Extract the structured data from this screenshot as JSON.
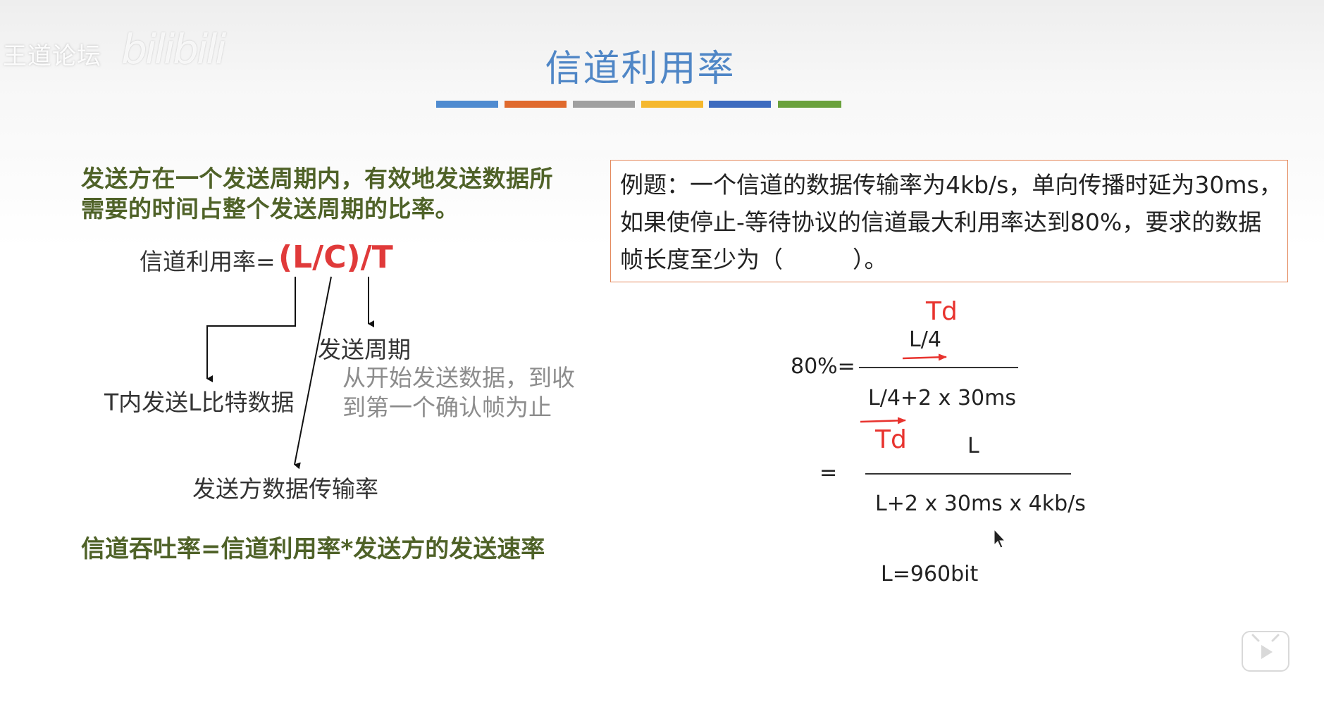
{
  "watermark": {
    "forum_text": "王道论坛",
    "bili_text": "bilibili"
  },
  "slide": {
    "title": "信道利用率",
    "color_bars": [
      "#4f8bd0",
      "#e06a2d",
      "#a0a0a0",
      "#f5b82e",
      "#3d6bbf",
      "#6aa13c"
    ],
    "definition": "发送方在一个发送周期内，有效地发送数据所需要的时间占整个发送周期的比率。",
    "formula_label": "信道利用率=",
    "formula": "(L/C)/T",
    "label_send_period": "发送周期",
    "label_T_data": "T内发送L比特数据",
    "note_line1": "从开始发送数据，到收",
    "note_line2": "到第一个确认帧为止",
    "label_rate": "发送方数据传输率",
    "throughput": "信道吞吐率=信道利用率*发送方的发送速率"
  },
  "example": {
    "text": "例题：一个信道的数据传输率为4kb/s，单向传播时延为30ms，如果使停止-等待协议的信道最大利用率达到80%，要求的数据帧长度至少为（　　　）。"
  },
  "solution": {
    "td_top": "Td",
    "numerator1": "L/4",
    "lhs": "80%=",
    "denominator1": "L/4+2 x 30ms",
    "td_mid": "Td",
    "equals": "=",
    "numerator2": "L",
    "denominator2": "L+2 x 30ms x 4kb/s",
    "result": "L=960bit"
  },
  "colors": {
    "title_blue": "#4f86c6",
    "definition_green": "#4f6228",
    "formula_red": "#e03a3a",
    "box_border": "#e48a5e",
    "td_red": "#e8332e"
  },
  "icons": {
    "player": "play-icon"
  }
}
